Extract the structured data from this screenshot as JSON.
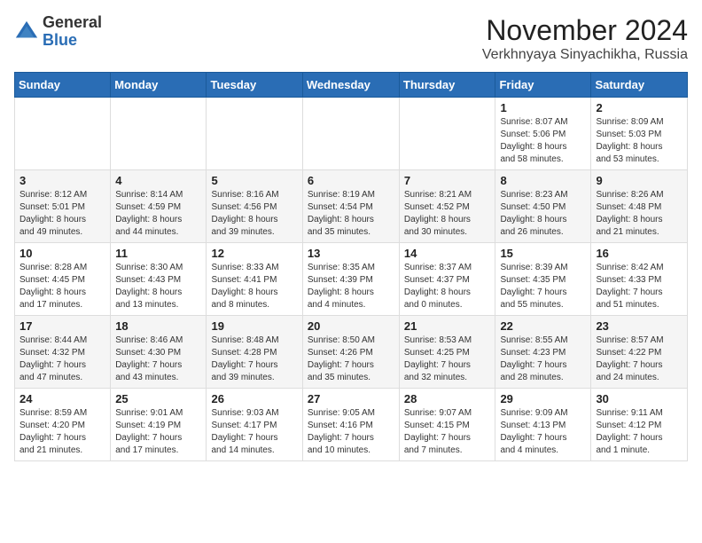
{
  "header": {
    "logo_general": "General",
    "logo_blue": "Blue",
    "month": "November 2024",
    "location": "Verkhnyaya Sinyachikha, Russia"
  },
  "weekdays": [
    "Sunday",
    "Monday",
    "Tuesday",
    "Wednesday",
    "Thursday",
    "Friday",
    "Saturday"
  ],
  "weeks": [
    [
      {
        "day": "",
        "info": ""
      },
      {
        "day": "",
        "info": ""
      },
      {
        "day": "",
        "info": ""
      },
      {
        "day": "",
        "info": ""
      },
      {
        "day": "",
        "info": ""
      },
      {
        "day": "1",
        "info": "Sunrise: 8:07 AM\nSunset: 5:06 PM\nDaylight: 8 hours\nand 58 minutes."
      },
      {
        "day": "2",
        "info": "Sunrise: 8:09 AM\nSunset: 5:03 PM\nDaylight: 8 hours\nand 53 minutes."
      }
    ],
    [
      {
        "day": "3",
        "info": "Sunrise: 8:12 AM\nSunset: 5:01 PM\nDaylight: 8 hours\nand 49 minutes."
      },
      {
        "day": "4",
        "info": "Sunrise: 8:14 AM\nSunset: 4:59 PM\nDaylight: 8 hours\nand 44 minutes."
      },
      {
        "day": "5",
        "info": "Sunrise: 8:16 AM\nSunset: 4:56 PM\nDaylight: 8 hours\nand 39 minutes."
      },
      {
        "day": "6",
        "info": "Sunrise: 8:19 AM\nSunset: 4:54 PM\nDaylight: 8 hours\nand 35 minutes."
      },
      {
        "day": "7",
        "info": "Sunrise: 8:21 AM\nSunset: 4:52 PM\nDaylight: 8 hours\nand 30 minutes."
      },
      {
        "day": "8",
        "info": "Sunrise: 8:23 AM\nSunset: 4:50 PM\nDaylight: 8 hours\nand 26 minutes."
      },
      {
        "day": "9",
        "info": "Sunrise: 8:26 AM\nSunset: 4:48 PM\nDaylight: 8 hours\nand 21 minutes."
      }
    ],
    [
      {
        "day": "10",
        "info": "Sunrise: 8:28 AM\nSunset: 4:45 PM\nDaylight: 8 hours\nand 17 minutes."
      },
      {
        "day": "11",
        "info": "Sunrise: 8:30 AM\nSunset: 4:43 PM\nDaylight: 8 hours\nand 13 minutes."
      },
      {
        "day": "12",
        "info": "Sunrise: 8:33 AM\nSunset: 4:41 PM\nDaylight: 8 hours\nand 8 minutes."
      },
      {
        "day": "13",
        "info": "Sunrise: 8:35 AM\nSunset: 4:39 PM\nDaylight: 8 hours\nand 4 minutes."
      },
      {
        "day": "14",
        "info": "Sunrise: 8:37 AM\nSunset: 4:37 PM\nDaylight: 8 hours\nand 0 minutes."
      },
      {
        "day": "15",
        "info": "Sunrise: 8:39 AM\nSunset: 4:35 PM\nDaylight: 7 hours\nand 55 minutes."
      },
      {
        "day": "16",
        "info": "Sunrise: 8:42 AM\nSunset: 4:33 PM\nDaylight: 7 hours\nand 51 minutes."
      }
    ],
    [
      {
        "day": "17",
        "info": "Sunrise: 8:44 AM\nSunset: 4:32 PM\nDaylight: 7 hours\nand 47 minutes."
      },
      {
        "day": "18",
        "info": "Sunrise: 8:46 AM\nSunset: 4:30 PM\nDaylight: 7 hours\nand 43 minutes."
      },
      {
        "day": "19",
        "info": "Sunrise: 8:48 AM\nSunset: 4:28 PM\nDaylight: 7 hours\nand 39 minutes."
      },
      {
        "day": "20",
        "info": "Sunrise: 8:50 AM\nSunset: 4:26 PM\nDaylight: 7 hours\nand 35 minutes."
      },
      {
        "day": "21",
        "info": "Sunrise: 8:53 AM\nSunset: 4:25 PM\nDaylight: 7 hours\nand 32 minutes."
      },
      {
        "day": "22",
        "info": "Sunrise: 8:55 AM\nSunset: 4:23 PM\nDaylight: 7 hours\nand 28 minutes."
      },
      {
        "day": "23",
        "info": "Sunrise: 8:57 AM\nSunset: 4:22 PM\nDaylight: 7 hours\nand 24 minutes."
      }
    ],
    [
      {
        "day": "24",
        "info": "Sunrise: 8:59 AM\nSunset: 4:20 PM\nDaylight: 7 hours\nand 21 minutes."
      },
      {
        "day": "25",
        "info": "Sunrise: 9:01 AM\nSunset: 4:19 PM\nDaylight: 7 hours\nand 17 minutes."
      },
      {
        "day": "26",
        "info": "Sunrise: 9:03 AM\nSunset: 4:17 PM\nDaylight: 7 hours\nand 14 minutes."
      },
      {
        "day": "27",
        "info": "Sunrise: 9:05 AM\nSunset: 4:16 PM\nDaylight: 7 hours\nand 10 minutes."
      },
      {
        "day": "28",
        "info": "Sunrise: 9:07 AM\nSunset: 4:15 PM\nDaylight: 7 hours\nand 7 minutes."
      },
      {
        "day": "29",
        "info": "Sunrise: 9:09 AM\nSunset: 4:13 PM\nDaylight: 7 hours\nand 4 minutes."
      },
      {
        "day": "30",
        "info": "Sunrise: 9:11 AM\nSunset: 4:12 PM\nDaylight: 7 hours\nand 1 minute."
      }
    ]
  ]
}
